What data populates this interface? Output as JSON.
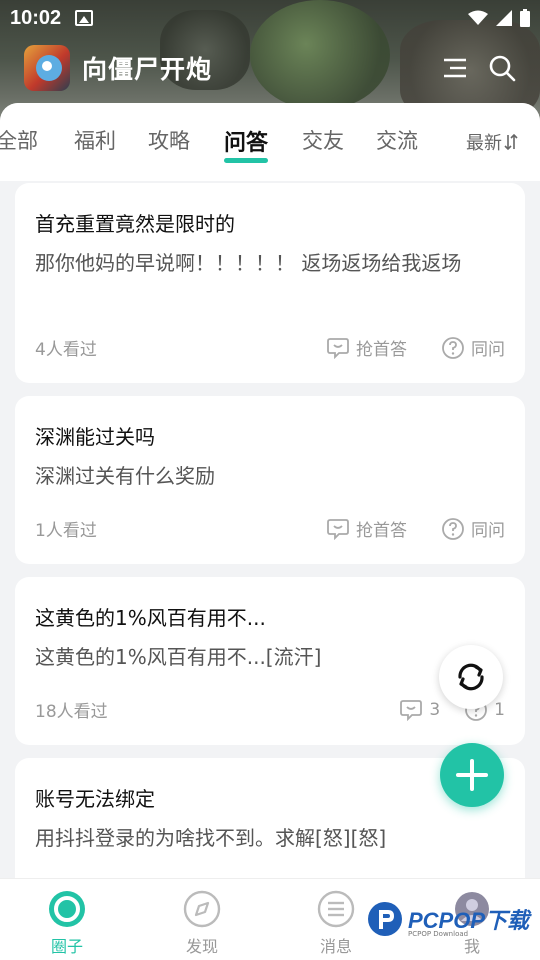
{
  "status": {
    "time": "10:02"
  },
  "app": {
    "title": "向僵尸开炮"
  },
  "tabs": [
    {
      "label": "全部"
    },
    {
      "label": "福利"
    },
    {
      "label": "攻略"
    },
    {
      "label": "问答"
    },
    {
      "label": "交友"
    },
    {
      "label": "交流"
    }
  ],
  "active_tab": "问答",
  "sort_label": "最新",
  "posts": [
    {
      "title": "首充重置竟然是限时的",
      "body": "那你他妈的早说啊！！！！！ 返场返场给我返场",
      "views": "4人看过",
      "answer": "抢首答",
      "same": "同问"
    },
    {
      "title": "深渊能过关吗",
      "body": "深渊过关有什么奖励",
      "views": "1人看过",
      "answer": "抢首答",
      "same": "同问"
    },
    {
      "title": "这黄色的1%风百有用不...",
      "body": "这黄色的1%风百有用不...[流汗]",
      "views": "18人看过",
      "answer": "3",
      "same": "1"
    },
    {
      "title": "账号无法绑定",
      "body": "用抖抖登录的为啥找不到。求解[怒][怒]",
      "views": "",
      "answer": "",
      "same": ""
    }
  ],
  "nav": [
    {
      "label": "圈子",
      "icon": "circle-icon"
    },
    {
      "label": "发现",
      "icon": "compass-icon"
    },
    {
      "label": "消息",
      "icon": "message-icon"
    },
    {
      "label": "我",
      "icon": "avatar-icon"
    }
  ],
  "watermark": {
    "brand": "PCPOP下载",
    "sub": "PCPOP Download"
  },
  "colors": {
    "accent": "#22c3a6",
    "text": "#111111",
    "muted": "#999999"
  }
}
